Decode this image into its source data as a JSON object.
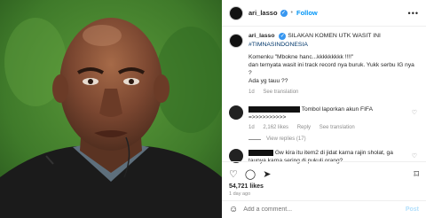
{
  "media": {
    "alt_subject": "referee-portrait"
  },
  "header": {
    "username": "ari_lasso",
    "verified": "✓",
    "dot": "•",
    "follow": "Follow",
    "more": "•••"
  },
  "caption": {
    "username": "ari_lasso",
    "verified": "✓",
    "text": "SILAKAN KOMEN UTK WASIT INI",
    "hashtag": "#TIMNASINDONESIA",
    "body_line1": "Komenku \"Mbokne hanc...kkkkkkkkk !!!!\"",
    "body_line2": "dan ternyata wasit ini track record nya buruk. Yukk serbu IG nya ?",
    "body_line3": "Ada yg tauu ??",
    "age": "1d",
    "see_translation": "See translation"
  },
  "comments": [
    {
      "text": "Tombol laporkan akun FIFA",
      "text2": "=>>>>>>>>>>",
      "age": "1d",
      "likes": "2,162 likes",
      "reply": "Reply",
      "see_translation": "See translation",
      "view_replies": "View replies (17)"
    },
    {
      "text": "Gw kira itu item2 di jidat karna rajin sholat, ga",
      "text2": "taunya karna sering di pukuli orang?"
    }
  ],
  "actions": {
    "like_icon": "♡",
    "comment_icon": "◯",
    "share_icon": "➤",
    "bookmark_icon": "⌑",
    "likes": "54,721 likes",
    "posted": "1 day ago"
  },
  "add_comment": {
    "smile_icon": "☺",
    "placeholder": "Add a comment...",
    "post": "Post"
  }
}
